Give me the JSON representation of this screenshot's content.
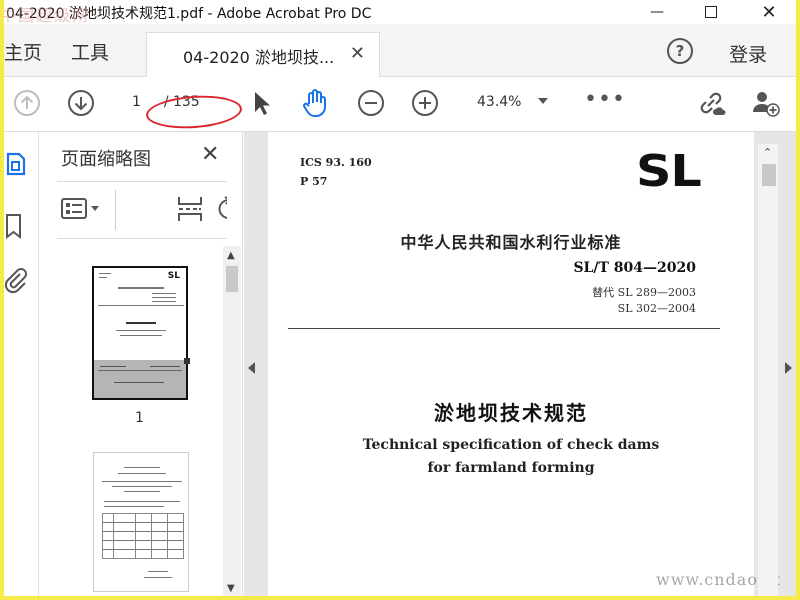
{
  "window": {
    "title": "04-2020 淤地坝技术规范1.pdf - Adobe Acrobat Pro DC",
    "watermark": "中国超级网"
  },
  "tabs": {
    "home": "主页",
    "tools": "工具",
    "document": "04-2020 淤地坝技...",
    "login": "登录"
  },
  "toolbar": {
    "page_current": "1",
    "page_total": "/ 135",
    "zoom": "43.4%"
  },
  "panel": {
    "title": "页面缩略图",
    "thumb1_label": "1"
  },
  "document": {
    "ics": "ICS 93. 160",
    "p_code": "P 57",
    "logo": "SL",
    "standard_cn": "中华人民共和国水利行业标准",
    "standard_no": "SL/T 804—2020",
    "replaces_1": "替代 SL 289—2003",
    "replaces_2": "SL 302—2004",
    "title_cn": "淤地坝技术规范",
    "title_en_1": "Technical specification of check dams",
    "title_en_2": "for farmland forming",
    "site_watermark": "www.cndao.com"
  },
  "colors": {
    "frame": "#f6ea4a",
    "hand_tool": "#1a73e8",
    "annotation_circle": "#d9262e"
  }
}
